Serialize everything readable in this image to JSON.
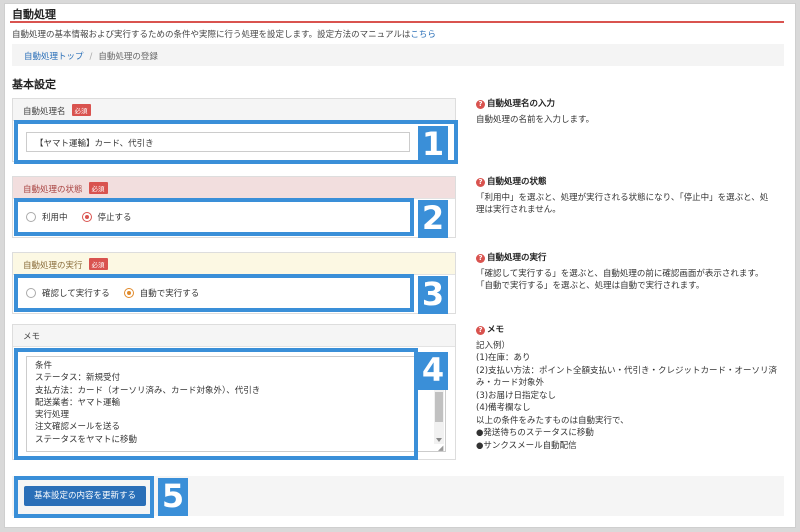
{
  "page": {
    "title": "自動処理",
    "description": "自動処理の基本情報および実行するための条件や実際に行う処理を設定します。設定方法のマニュアルは",
    "manual_link": "こちら",
    "breadcrumb": {
      "home": "自動処理トップ",
      "separator": "/",
      "current": "自動処理の登録"
    },
    "section_title": "基本設定"
  },
  "form": {
    "required_badge": "必須",
    "name": {
      "label": "自動処理名",
      "value": "【ヤマト運輸】カード、代引き",
      "marker": "1"
    },
    "status": {
      "label": "自動処理の状態",
      "options": [
        "利用中",
        "停止する"
      ],
      "selected": "停止する",
      "marker": "2"
    },
    "execution": {
      "label": "自動処理の実行",
      "options": [
        "確認して実行する",
        "自動で実行する"
      ],
      "selected": "自動で実行する",
      "marker": "3"
    },
    "memo": {
      "label": "メモ",
      "lines": [
        "条件",
        "ステータス：新規受付",
        "支払方法：カード（オーソリ済み、カード対象外）、代引き",
        "配送業者：ヤマト運輸",
        "実行処理",
        "注文確認メールを送る",
        "ステータスをヤマトに移動"
      ],
      "marker": "4"
    },
    "submit": {
      "label": "基本設定の内容を更新する",
      "marker": "5"
    }
  },
  "help": {
    "icon": "question-circle-icon",
    "name": {
      "title": "自動処理名の入力",
      "lines": [
        "自動処理の名前を入力します。"
      ]
    },
    "status": {
      "title": "自動処理の状態",
      "lines": [
        "「利用中」を選ぶと、処理が実行される状態になり、「停止中」を選ぶと、処",
        "理は実行されません。"
      ]
    },
    "execution": {
      "title": "自動処理の実行",
      "lines": [
        "「確認して実行する」を選ぶと、自動処理の前に確認画面が表示されます。",
        "「自動で実行する」を選ぶと、処理は自動で実行されます。"
      ]
    },
    "memo": {
      "title": "メモ",
      "lines": [
        "記入例）",
        "(1)在庫：あり",
        "(2)支払い方法：ポイント全額支払い・代引き・クレジットカード・オーソリ済",
        "み・カード対象外",
        "(3)お届け日指定なし",
        "(4)備考欄なし",
        "以上の条件をみたすものは自動実行で、",
        "●発送待ちのステータスに移動",
        "●サンクスメール自動配信"
      ]
    }
  },
  "colors": {
    "accent_blue": "#3a8fd8",
    "required_red": "#d9534f",
    "link_blue": "#2a6fb8"
  }
}
